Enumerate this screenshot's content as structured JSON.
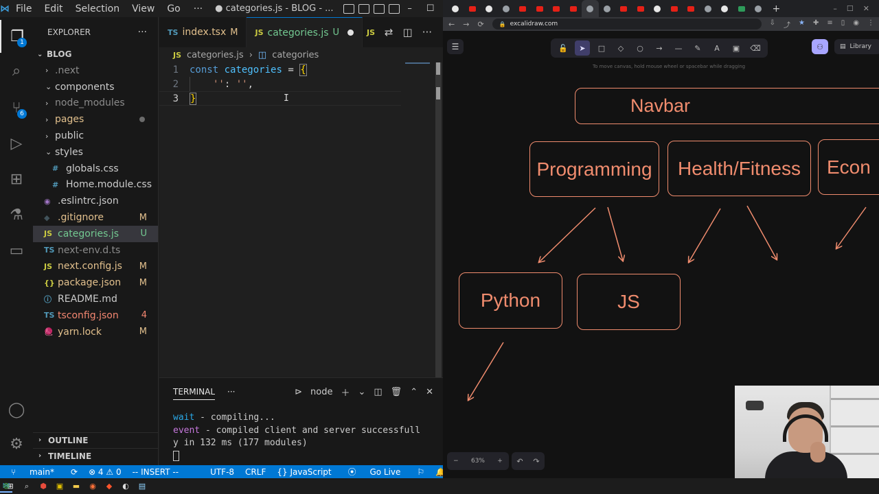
{
  "vscode": {
    "menu": [
      "File",
      "Edit",
      "Selection",
      "View",
      "Go"
    ],
    "menu_more": "···",
    "window_title": "● categories.js - BLOG - ...",
    "explorer": {
      "title": "EXPLORER",
      "more": "···",
      "root": "BLOG",
      "items": [
        {
          "label": ".next",
          "chevron": "›",
          "icon": "",
          "status": ""
        },
        {
          "label": "components",
          "chevron": "⌄",
          "icon": "",
          "status": ""
        },
        {
          "label": "node_modules",
          "chevron": "›",
          "icon": "",
          "status": ""
        },
        {
          "label": "pages",
          "chevron": "›",
          "icon": "",
          "status": ""
        },
        {
          "label": "public",
          "chevron": "›",
          "icon": "",
          "status": ""
        },
        {
          "label": "styles",
          "chevron": "⌄",
          "icon": "",
          "status": ""
        },
        {
          "label": "globals.css",
          "chevron": "",
          "icon": "#",
          "status": ""
        },
        {
          "label": "Home.module.css",
          "chevron": "",
          "icon": "#",
          "status": ""
        },
        {
          "label": ".eslintrc.json",
          "chevron": "",
          "icon": "◉",
          "status": ""
        },
        {
          "label": ".gitignore",
          "chevron": "",
          "icon": "◆",
          "status": "M"
        },
        {
          "label": "categories.js",
          "chevron": "",
          "icon": "JS",
          "status": "U"
        },
        {
          "label": "next-env.d.ts",
          "chevron": "",
          "icon": "TS",
          "status": ""
        },
        {
          "label": "next.config.js",
          "chevron": "",
          "icon": "JS",
          "status": "M"
        },
        {
          "label": "package.json",
          "chevron": "",
          "icon": "{}",
          "status": "M"
        },
        {
          "label": "README.md",
          "chevron": "",
          "icon": "ⓘ",
          "status": ""
        },
        {
          "label": "tsconfig.json",
          "chevron": "",
          "icon": "TS",
          "status": "4"
        },
        {
          "label": "yarn.lock",
          "chevron": "",
          "icon": "🧶",
          "status": "M"
        }
      ],
      "outline": "OUTLINE",
      "timeline": "TIMELINE"
    },
    "activity_badges": {
      "explorer": "1",
      "scm": "6"
    },
    "tabs": [
      {
        "icon": "TS",
        "label": "index.tsx",
        "status": "M"
      },
      {
        "icon": "JS",
        "label": "categories.js",
        "status": "U"
      },
      {
        "icon": "JS",
        "label": "",
        "status": ""
      }
    ],
    "breadcrumb": {
      "file_icon": "JS",
      "file": "categories.js",
      "symbol_icon": "◫",
      "symbol": "categories"
    },
    "code": {
      "line_numbers": [
        "1",
        "2",
        "3"
      ],
      "line1": {
        "kw": "const",
        "name": "categories",
        "op": "=",
        "brace": "{"
      },
      "line2": {
        "key": "''",
        "colon": ":",
        "val": "''",
        "comma": ","
      },
      "line3": {
        "brace": "}"
      }
    },
    "terminal": {
      "tab_label": "TERMINAL",
      "more": "···",
      "shell": "node",
      "lines": [
        {
          "tag": "wait",
          "text": "  - compiling..."
        },
        {
          "tag": "event",
          "text": " - compiled client and server successfull"
        },
        {
          "tag": "",
          "text": "y in 132 ms (177 modules)"
        }
      ]
    },
    "status": {
      "branch": "main*",
      "problems": "⊗ 4 ⚠ 0",
      "mode": "-- INSERT --",
      "encoding": "UTF-8",
      "eol": "CRLF",
      "language": "{} JavaScript",
      "live": "Go Live"
    }
  },
  "browser": {
    "url": "excalidraw.com",
    "hint": "To move canvas, hold mouse wheel or spacebar while dragging",
    "library_label": "Library",
    "zoom_level": "63%",
    "zoom_out": "−",
    "zoom_in": "+",
    "undo": "↶",
    "redo": "↷",
    "shapes": [
      {
        "label": "Navbar"
      },
      {
        "label": "Programming"
      },
      {
        "label": "Health/Fitness"
      },
      {
        "label": "Econ"
      },
      {
        "label": "Python"
      },
      {
        "label": "JS"
      }
    ]
  },
  "colors": {
    "vscode_accent": "#0078d4",
    "excalidraw_stroke": "#f08c6e",
    "modified": "#e2c08d",
    "untracked": "#73c991"
  }
}
